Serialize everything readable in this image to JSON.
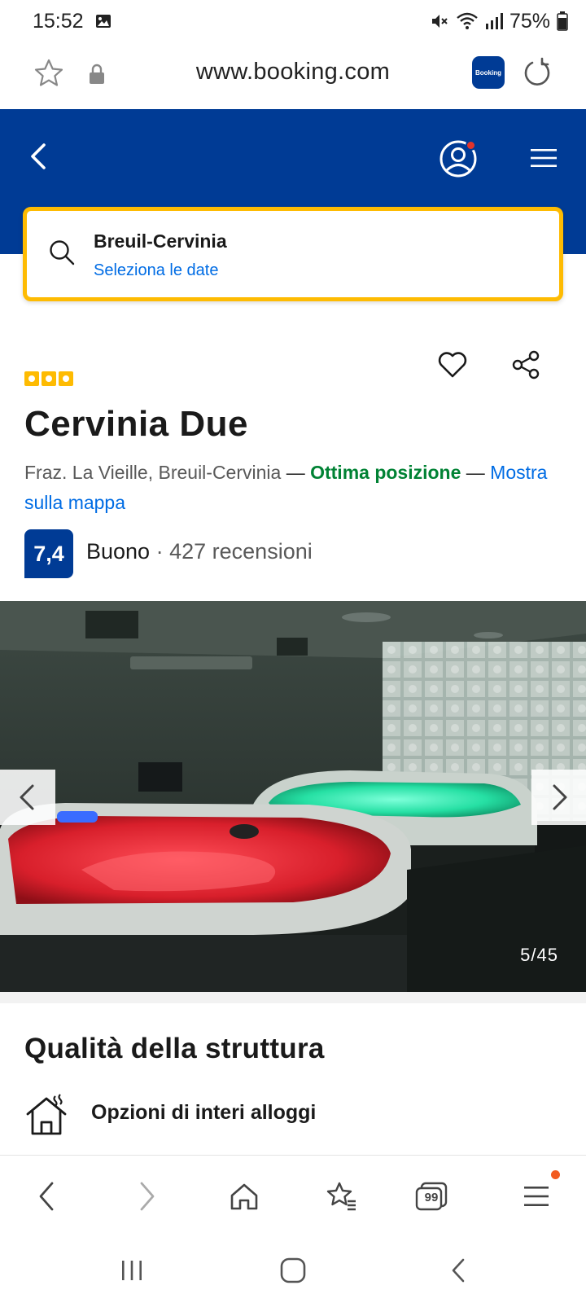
{
  "status_bar": {
    "time": "15:52",
    "battery": "75%"
  },
  "browser": {
    "url": "www.booking.com",
    "app_badge": "Booking",
    "badge_color": "#003b95"
  },
  "header": {
    "background_color": "#003b95",
    "notification_color": "#e2342b"
  },
  "search": {
    "destination": "Breuil-Cervinia",
    "dates_link": "Seleziona le date",
    "border_color": "#febb02"
  },
  "hotel": {
    "star_rating": 3,
    "name": "Cervinia Due",
    "address": "Fraz. La Vieille, Breuil-Cervinia",
    "dash": "—",
    "location_highlight": "Ottima posizione",
    "map_link": "Mostra sulla mappa",
    "score": "7,4",
    "score_label": "Buono",
    "separator": "·",
    "reviews": "427 recensioni"
  },
  "gallery": {
    "counter": "5/45"
  },
  "facilities": {
    "title": "Qualità della struttura",
    "items": [
      {
        "icon": "house-heating-icon",
        "label": "Opzioni di interi alloggi"
      }
    ]
  },
  "browser_nav": {
    "tabs_count": "99",
    "menu_dot_color": "#f25a1f"
  }
}
